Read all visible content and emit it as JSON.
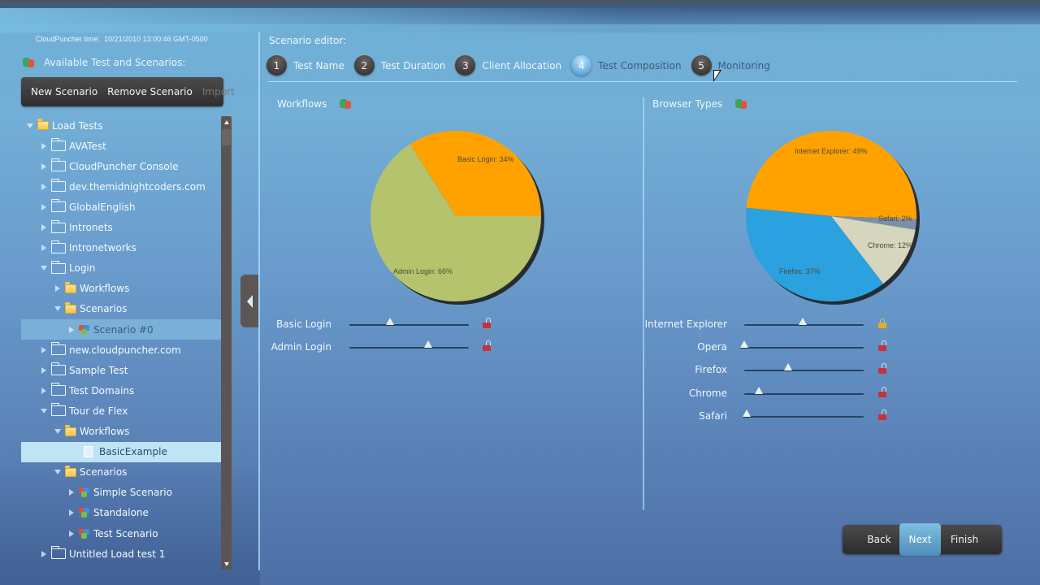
{
  "header": {
    "clock_label": "CloudPuncher time:",
    "clock_value": "10/21/2010 13:00:46 GMT-0500",
    "available_label": "Available Test and Scenarios:"
  },
  "toolbar": {
    "new_scenario": "New Scenario",
    "remove_scenario": "Remove Scenario",
    "import": "Import"
  },
  "tree": {
    "items": [
      {
        "label": "Load Tests",
        "level": 0,
        "expander": "down",
        "icon": "folder-yellow-icon",
        "state": ""
      },
      {
        "label": "AVATest",
        "level": 1,
        "expander": "right",
        "icon": "folder-icon",
        "state": ""
      },
      {
        "label": "CloudPuncher Console",
        "level": 1,
        "expander": "right",
        "icon": "folder-icon",
        "state": ""
      },
      {
        "label": "dev.themidnightcoders.com",
        "level": 1,
        "expander": "right",
        "icon": "folder-icon",
        "state": ""
      },
      {
        "label": "GlobalEnglish",
        "level": 1,
        "expander": "right",
        "icon": "folder-icon",
        "state": ""
      },
      {
        "label": "Intronets",
        "level": 1,
        "expander": "right",
        "icon": "folder-icon",
        "state": ""
      },
      {
        "label": "Intronetworks",
        "level": 1,
        "expander": "right",
        "icon": "folder-icon",
        "state": ""
      },
      {
        "label": "Login",
        "level": 1,
        "expander": "down",
        "icon": "folder-icon",
        "state": ""
      },
      {
        "label": "Workflows",
        "level": 2,
        "expander": "right",
        "icon": "folder-yellow-icon",
        "state": ""
      },
      {
        "label": "Scenarios",
        "level": 2,
        "expander": "down",
        "icon": "folder-yellow-icon",
        "state": ""
      },
      {
        "label": "Scenario #0",
        "level": 3,
        "expander": "right",
        "icon": "scenario-icon",
        "state": "hover"
      },
      {
        "label": "new.cloudpuncher.com",
        "level": 1,
        "expander": "right",
        "icon": "folder-icon",
        "state": ""
      },
      {
        "label": "Sample Test",
        "level": 1,
        "expander": "right",
        "icon": "folder-icon",
        "state": ""
      },
      {
        "label": "Test Domains",
        "level": 1,
        "expander": "right",
        "icon": "folder-icon",
        "state": ""
      },
      {
        "label": "Tour de Flex",
        "level": 1,
        "expander": "down",
        "icon": "folder-icon",
        "state": ""
      },
      {
        "label": "Workflows",
        "level": 2,
        "expander": "down",
        "icon": "folder-yellow-icon",
        "state": ""
      },
      {
        "label": "BasicExample",
        "level": 3,
        "expander": "none",
        "icon": "document-icon",
        "state": "selected"
      },
      {
        "label": "Scenarios",
        "level": 2,
        "expander": "down",
        "icon": "folder-yellow-icon",
        "state": ""
      },
      {
        "label": "Simple Scenario",
        "level": 3,
        "expander": "right",
        "icon": "scenario-icon",
        "state": ""
      },
      {
        "label": "Standalone",
        "level": 3,
        "expander": "right",
        "icon": "scenario-icon",
        "state": ""
      },
      {
        "label": "Test Scenario",
        "level": 3,
        "expander": "right",
        "icon": "scenario-icon",
        "state": ""
      },
      {
        "label": "Untitled Load test 1",
        "level": 1,
        "expander": "right",
        "icon": "folder-icon",
        "state": ""
      }
    ]
  },
  "editor": {
    "title": "Scenario editor:",
    "steps": [
      {
        "num": "1",
        "label": "Test Name",
        "status": "done"
      },
      {
        "num": "2",
        "label": "Test Duration",
        "status": "done"
      },
      {
        "num": "3",
        "label": "Client Allocation",
        "status": "done"
      },
      {
        "num": "4",
        "label": "Test Composition",
        "status": "active"
      },
      {
        "num": "5",
        "label": "Monitoring",
        "status": "future"
      }
    ],
    "workflows": {
      "title": "Workflows",
      "sliders": [
        {
          "label": "Basic Login",
          "value": 34,
          "locked": false
        },
        {
          "label": "Admin Login",
          "value": 66,
          "locked": false
        }
      ]
    },
    "browsers": {
      "title": "Browser Types",
      "sliders": [
        {
          "label": "Internet Explorer",
          "value": 49,
          "locked": true
        },
        {
          "label": "Opera",
          "value": 0,
          "locked": false
        },
        {
          "label": "Firefox",
          "value": 37,
          "locked": false
        },
        {
          "label": "Chrome",
          "value": 12,
          "locked": false
        },
        {
          "label": "Safari",
          "value": 2,
          "locked": false
        }
      ]
    }
  },
  "nav": {
    "back": "Back",
    "next": "Next",
    "finish": "Finish"
  },
  "chart_data": [
    {
      "type": "pie",
      "title": "Workflows",
      "categories": [
        "Basic Login",
        "Admin Login"
      ],
      "values": [
        34,
        66
      ],
      "labels": [
        "Basic Login:  34%",
        "Admin Login:  66%"
      ],
      "colors": [
        "#ffa200",
        "#b5c46c"
      ]
    },
    {
      "type": "pie",
      "title": "Browser Types",
      "categories": [
        "Internet Explorer",
        "Safari",
        "Chrome",
        "Firefox"
      ],
      "values": [
        49,
        2,
        12,
        37
      ],
      "labels": [
        "Internet Explorer:  49%",
        "Safari:  2%",
        "Chrome:  12%",
        "Firefox:  37%"
      ],
      "colors": [
        "#ffa200",
        "#7c8fa8",
        "#d6d5bd",
        "#2ba1df"
      ]
    }
  ]
}
